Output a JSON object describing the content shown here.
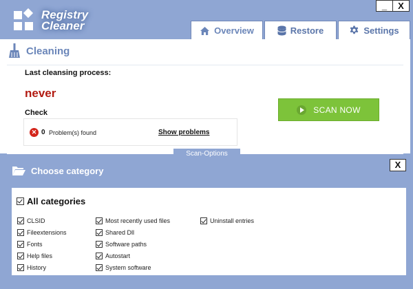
{
  "app": {
    "title_line1": "Registry",
    "title_line2": "Cleaner"
  },
  "window": {
    "minimize_label": "_",
    "close_label": "X"
  },
  "tabs": [
    {
      "label": "Overview",
      "icon": "home-icon",
      "active": true
    },
    {
      "label": "Restore",
      "icon": "database-icon",
      "active": false
    },
    {
      "label": "Settings",
      "icon": "gear-icon",
      "active": false
    }
  ],
  "cleaning": {
    "title": "Cleaning",
    "last_process_label": "Last cleansing process:",
    "last_process_value": "never",
    "check_label": "Check",
    "problem_count": "0",
    "problem_label": "Problem(s) found",
    "show_problems_label": "Show problems",
    "scan_button_label": "SCAN NOW",
    "scan_options_label": "Scan-Options"
  },
  "category": {
    "title": "Choose category",
    "close_label": "X",
    "all_label": "All categories",
    "columns": [
      [
        "CLSID",
        "Fileextensions",
        "Fonts",
        "Help files",
        "History"
      ],
      [
        "Most recently used files",
        "Shared Dll",
        "Software paths",
        "Autostart",
        "System software"
      ],
      [
        "Uninstall entries"
      ]
    ]
  },
  "colors": {
    "background": "#8fa6d3",
    "accent_blue": "#6b86b9",
    "scan_green": "#7dc33a",
    "never_red": "#b21b12",
    "error_red": "#d3251b"
  }
}
